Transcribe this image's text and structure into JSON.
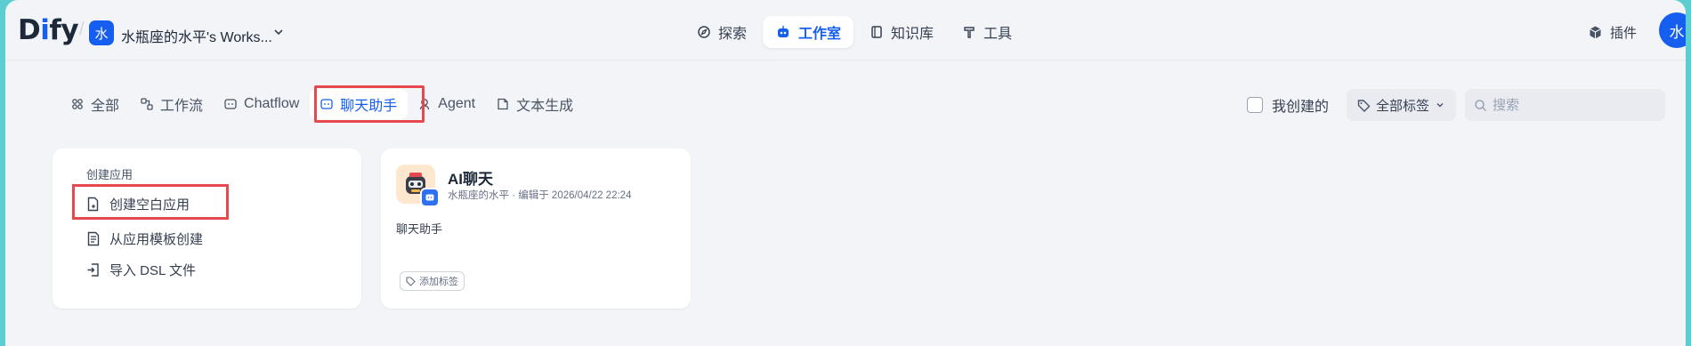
{
  "header": {
    "logo_left": "D",
    "logo_blue": "i",
    "logo_right": "fy",
    "workspace_avatar": "水",
    "workspace_name": "水瓶座的水平's Works...",
    "nav": [
      {
        "label": "探索",
        "icon": "compass-icon"
      },
      {
        "label": "工作室",
        "icon": "robot-icon",
        "active": true
      },
      {
        "label": "知识库",
        "icon": "book-icon"
      },
      {
        "label": "工具",
        "icon": "hammer-icon"
      }
    ],
    "plugins_label": "插件",
    "user_avatar": "水"
  },
  "tabs": [
    {
      "label": "全部",
      "icon": "grid-icon"
    },
    {
      "label": "工作流",
      "icon": "workflow-icon"
    },
    {
      "label": "Chatflow",
      "icon": "chatflow-icon"
    },
    {
      "label": "聊天助手",
      "icon": "chat-bot-icon",
      "active": true
    },
    {
      "label": "Agent",
      "icon": "agent-icon"
    },
    {
      "label": "文本生成",
      "icon": "document-icon"
    }
  ],
  "filters": {
    "created_by_me": "我创建的",
    "all_tags": "全部标签",
    "search_placeholder": "搜索"
  },
  "create_card": {
    "title": "创建应用",
    "items": [
      {
        "label": "创建空白应用",
        "icon": "new-file-icon"
      },
      {
        "label": "从应用模板创建",
        "icon": "template-icon"
      },
      {
        "label": "导入 DSL 文件",
        "icon": "import-icon"
      }
    ]
  },
  "apps": [
    {
      "name": "AI聊天",
      "author": "水瓶座的水平",
      "edited": "编辑于 2026/04/22 22:24",
      "description": "聊天助手",
      "add_tag_label": "添加标签"
    }
  ],
  "colors": {
    "accent": "#155eef",
    "highlight": "#e5484d",
    "background": "#f2f4f7",
    "outer": "#5ccdd0"
  }
}
